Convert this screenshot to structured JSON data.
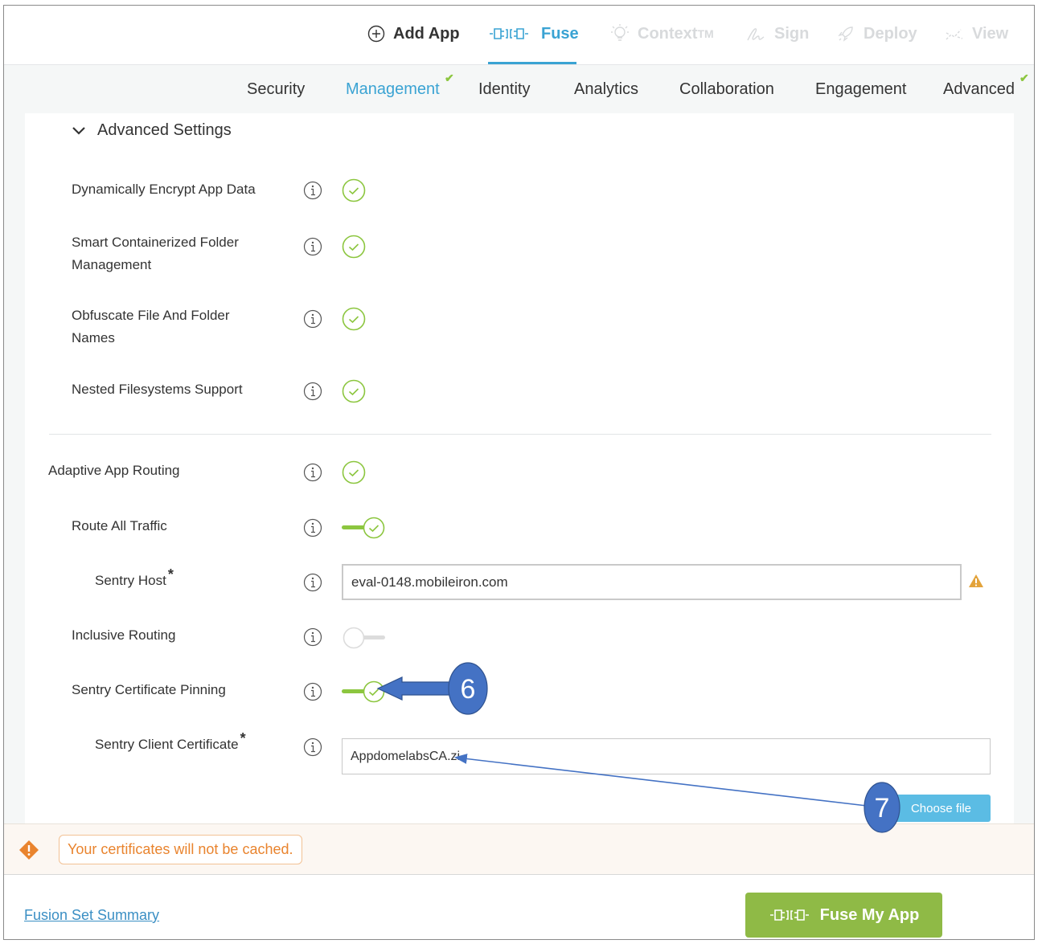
{
  "steps": [
    {
      "label": "Add App",
      "icon": "plus-circle-icon",
      "state": "done"
    },
    {
      "label": "Fuse",
      "icon": "plug-icon",
      "state": "active"
    },
    {
      "label": "Context",
      "sup": "TM",
      "icon": "lightbulb-icon",
      "state": "disabled"
    },
    {
      "label": "Sign",
      "icon": "signature-icon",
      "state": "disabled"
    },
    {
      "label": "Deploy",
      "icon": "rocket-icon",
      "state": "disabled"
    },
    {
      "label": "View",
      "icon": "chart-icon",
      "state": "disabled"
    }
  ],
  "subtabs": [
    {
      "label": "Security",
      "active": false,
      "checked": false
    },
    {
      "label": "Management",
      "active": true,
      "checked": true
    },
    {
      "label": "Identity",
      "active": false,
      "checked": false
    },
    {
      "label": "Analytics",
      "active": false,
      "checked": false
    },
    {
      "label": "Collaboration",
      "active": false,
      "checked": false
    },
    {
      "label": "Engagement",
      "active": false,
      "checked": false
    },
    {
      "label": "Advanced",
      "active": false,
      "checked": true
    }
  ],
  "advanced": {
    "header": "Advanced Settings",
    "options": [
      {
        "label": "Dynamically Encrypt App Data",
        "enabled": true
      },
      {
        "label_line1": "Smart Containerized Folder",
        "label_line2": "Management",
        "enabled": true
      },
      {
        "label_line1": "Obfuscate File And Folder",
        "label_line2": "Names",
        "enabled": true
      },
      {
        "label": "Nested Filesystems Support",
        "enabled": true
      }
    ]
  },
  "routing": {
    "label": "Adaptive App Routing",
    "enabled": true,
    "route_all": {
      "label": "Route All Traffic",
      "on": true
    },
    "sentry_host": {
      "label": "Sentry Host",
      "required": "*",
      "value": "eval-0148.mobileiron.com",
      "status": "warning"
    },
    "inclusive": {
      "label": "Inclusive Routing",
      "on": false
    },
    "pinning": {
      "label": "Sentry Certificate Pinning",
      "on": true
    },
    "client_cert": {
      "label": "Sentry Client Certificate",
      "required": "*",
      "value": "AppdomelabsCA.zi",
      "button": "Choose file"
    }
  },
  "warning": {
    "text": "Your certificates will not be cached."
  },
  "footer": {
    "summary_link": "Fusion Set Summary",
    "fuse_button": "Fuse My App"
  },
  "annotations": [
    {
      "number": "6"
    },
    {
      "number": "7"
    }
  ],
  "colors": {
    "accent": "#3aa3d3",
    "green": "#8cc63f",
    "button_green": "#8fba46",
    "warning": "#e9842e",
    "annotation": "#4472c4"
  }
}
